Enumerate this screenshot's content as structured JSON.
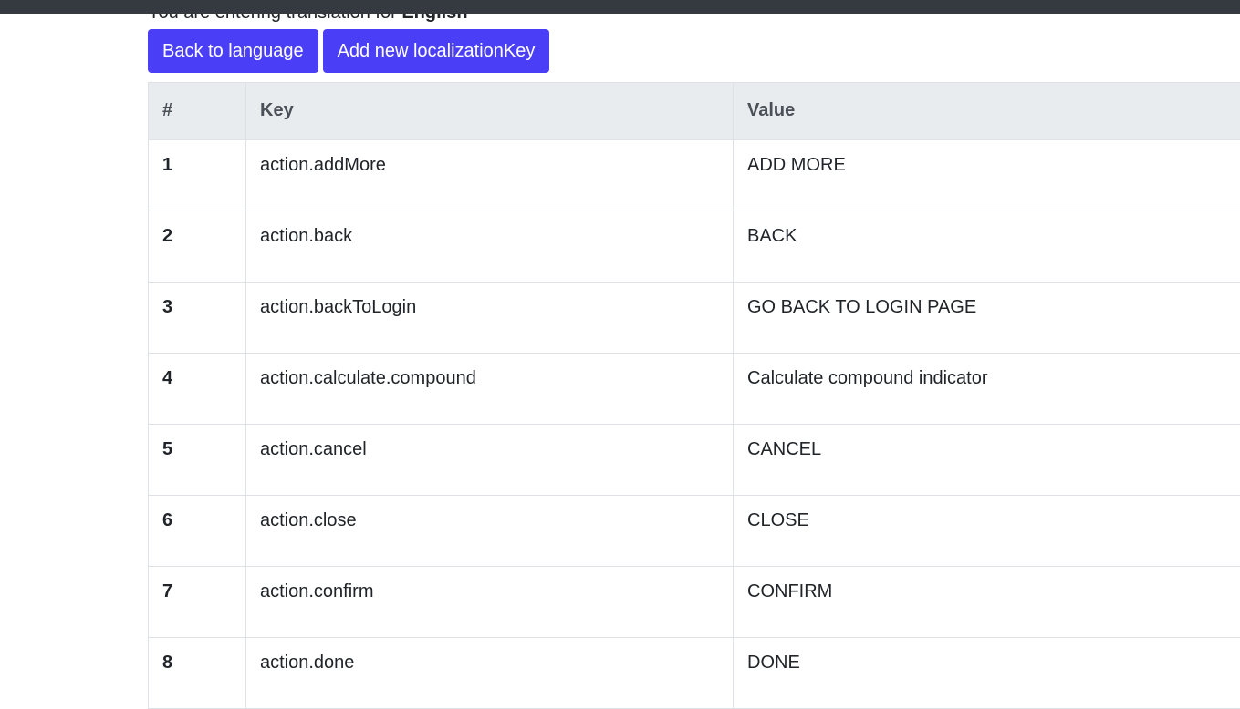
{
  "header": {
    "notice_prefix": "You are entering translation for ",
    "notice_language": "English"
  },
  "toolbar": {
    "back_label": "Back to language",
    "add_label": "Add new localizationKey"
  },
  "table": {
    "columns": [
      "#",
      "Key",
      "Value"
    ],
    "rows": [
      {
        "num": "1",
        "key": "action.addMore",
        "value": "ADD MORE"
      },
      {
        "num": "2",
        "key": "action.back",
        "value": "BACK"
      },
      {
        "num": "3",
        "key": "action.backToLogin",
        "value": "GO BACK TO LOGIN PAGE"
      },
      {
        "num": "4",
        "key": "action.calculate.compound",
        "value": "Calculate compound indicator"
      },
      {
        "num": "5",
        "key": "action.cancel",
        "value": "CANCEL"
      },
      {
        "num": "6",
        "key": "action.close",
        "value": "CLOSE"
      },
      {
        "num": "7",
        "key": "action.confirm",
        "value": "CONFIRM"
      },
      {
        "num": "8",
        "key": "action.done",
        "value": "DONE"
      }
    ]
  },
  "colors": {
    "button_bg": "#4a3ff7",
    "topbar_bg": "#343a40",
    "header_bg": "#e9ecef"
  }
}
